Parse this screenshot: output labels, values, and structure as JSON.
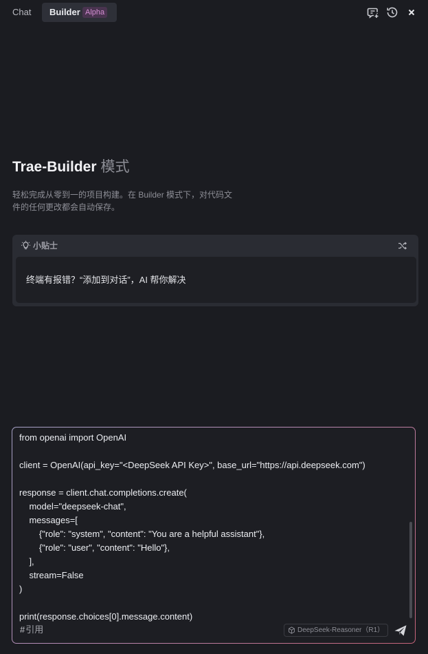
{
  "header": {
    "tabs": [
      {
        "label": "Chat"
      },
      {
        "label": "Builder",
        "badge": "Alpha"
      }
    ],
    "icons": [
      "new-chat-icon",
      "history-icon",
      "close-icon"
    ]
  },
  "intro": {
    "title_main": "Trae-Builder",
    "title_suffix": "模式",
    "description": "轻松完成从零到一的项目构建。在 Builder 模式下，对代码文件的任何更改都会自动保存。"
  },
  "tip": {
    "title": "小贴士",
    "text": "终端有报错？“添加到对话”，AI 帮你解决",
    "icons": [
      "lightbulb-icon",
      "shuffle-icon"
    ]
  },
  "composer": {
    "code": "from openai import OpenAI\n\nclient = OpenAI(api_key=\"<DeepSeek API Key>\", base_url=\"https://api.deepseek.com\")\n\nresponse = client.chat.completions.create(\n    model=\"deepseek-chat\",\n    messages=[\n        {\"role\": \"system\", \"content\": \"You are a helpful assistant\"},\n        {\"role\": \"user\", \"content\": \"Hello\"},\n    ],\n    stream=False\n)\n\nprint(response.choices[0].message.content)",
    "quote_hash": "#",
    "quote_label": "引用",
    "model_label": "DeepSeek-Reasoner（R1）",
    "icons": [
      "cube-icon",
      "send-icon"
    ]
  },
  "colors": {
    "background": "#1b1c21",
    "badge_text": "#d58fd4",
    "border_gradient_start": "#a7a2c7",
    "border_gradient_end": "#c8647a"
  }
}
